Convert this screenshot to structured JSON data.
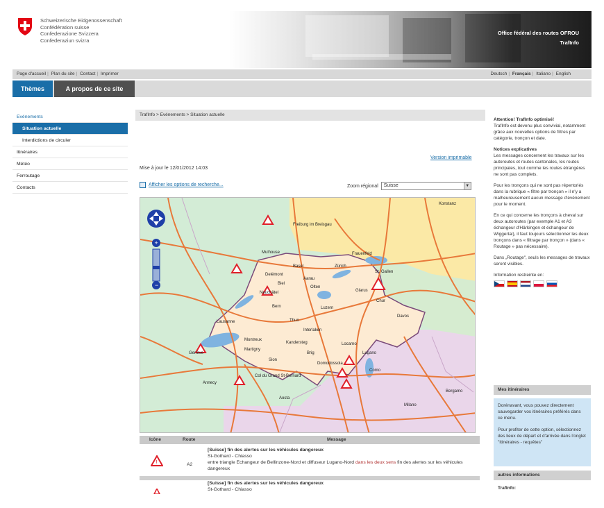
{
  "header": {
    "confederation": [
      "Schweizerische Eidgenossenschaft",
      "Confédération suisse",
      "Confederazione Svizzera",
      "Confederaziun svizra"
    ],
    "office": "Office fédéral des routes OFROU",
    "service": "TrafInfo"
  },
  "topbar": {
    "links": [
      "Page d'accueil",
      "Plan du site",
      "Contact",
      "Imprimer"
    ],
    "languages": [
      "Deutsch",
      "Français",
      "Italiano",
      "English"
    ]
  },
  "tabs": [
    "Thèmes",
    "A propos de ce site"
  ],
  "leftnav": [
    {
      "label": "Evénements",
      "style": "blue"
    },
    {
      "label": "Situation actuelle",
      "style": "active"
    },
    {
      "label": "Interdictions de circuler",
      "style": "sub"
    },
    {
      "label": "Itinéraires",
      "style": "normal"
    },
    {
      "label": "Météo",
      "style": "normal"
    },
    {
      "label": "Ferroutage",
      "style": "normal"
    },
    {
      "label": "Contacts",
      "style": "normal"
    }
  ],
  "main": {
    "breadcrumb": "TrafInfo > Evénements > Situation actuelle",
    "print_label": "Version imprimable",
    "updated": "Mise à jour le 12/01/2012 14:03",
    "search_options": "Afficher les options de recherche...",
    "zoom_label": "Zoom régional",
    "zoom_value": "Suisse"
  },
  "map": {
    "places": [
      "Freiburg im Breisgau",
      "Konstanz",
      "Mulhouse",
      "Basel",
      "Zürich",
      "St. Gallen",
      "Delémont",
      "Aarau",
      "Neuchâtel",
      "Bern",
      "Luzern",
      "Chur",
      "Davos",
      "Lausanne",
      "Montreux",
      "Sion",
      "Thun",
      "Interlaken",
      "Kandersteg",
      "Genève",
      "Annecy",
      "Aosta",
      "Lugano",
      "Locarno",
      "Como",
      "Milano",
      "Bergamo",
      "Domodossola",
      "Martigny",
      "Col du Grand St-Bernard",
      "Olten",
      "Frauenfeld",
      "Glarus",
      "Brig",
      "Biel"
    ]
  },
  "table": {
    "headers": [
      "Icône",
      "Route",
      "Message"
    ],
    "rows": [
      {
        "route": "A2",
        "title": "[Suisse] fin des alertes sur les véhicules dangereux",
        "location": "St-Gothard - Chiasso",
        "text_before": "entre triangle Echangeur de Bellinzone-Nord et diffuseur Lugano-Nord",
        "text_highlight": "dans les deux sens",
        "text_after": "fin des alertes sur les véhicules dangereux"
      },
      {
        "route": "",
        "title": "[Suisse] fin des alertes sur les véhicules dangereux",
        "location": "St-Gothard - Chiasso"
      }
    ]
  },
  "right": {
    "p1_title": "Attention! TrafInfo optimisé!",
    "p1": "TrafInfo est devenu plus convivial, notamment grâce aux nouvelles options de filtres par catégorie, tronçon et date.",
    "p2_title": "Notices explicatives",
    "p2": "Les messages concernent les travaux sur les autoroutes et routes cantonales, les routes principales, tout comme les routes étrangères ne sont pas complets.",
    "p3": "Pour les tronçons qui ne sont pas répertoriés dans la rubrique « filtre par tronçon » il n'y a malheureusement aucun message d'événement pour le moment.",
    "p4": "En ce qui concerne les tronçons à cheval sur deux autoroutes (par exemple A1 et A3 échangeur d'Härkingen et échangeur de Wiggertal), il faut toujours sélectionner les deux tronçons dans « filtrage par tronçon » (dans « Routage » pas nécessaire).",
    "p5": "Dans „Routage\", seuls les messages de travaux seront visibles.",
    "p6": "Information restreinte en:",
    "box1_title": "Mes itinéraires",
    "box1_p1": "Dorénavant, vous pouvez directement sauvegarder vos itinéraires préférés dans ce menu.",
    "box1_p2": "Pour profiter de cette option, sélectionnez des lieux de départ et d'arrivée dans l'onglet \"Itinéraires - requêtes\"",
    "box2_title": "autres informations",
    "box2_text": "TrafInfo:"
  }
}
